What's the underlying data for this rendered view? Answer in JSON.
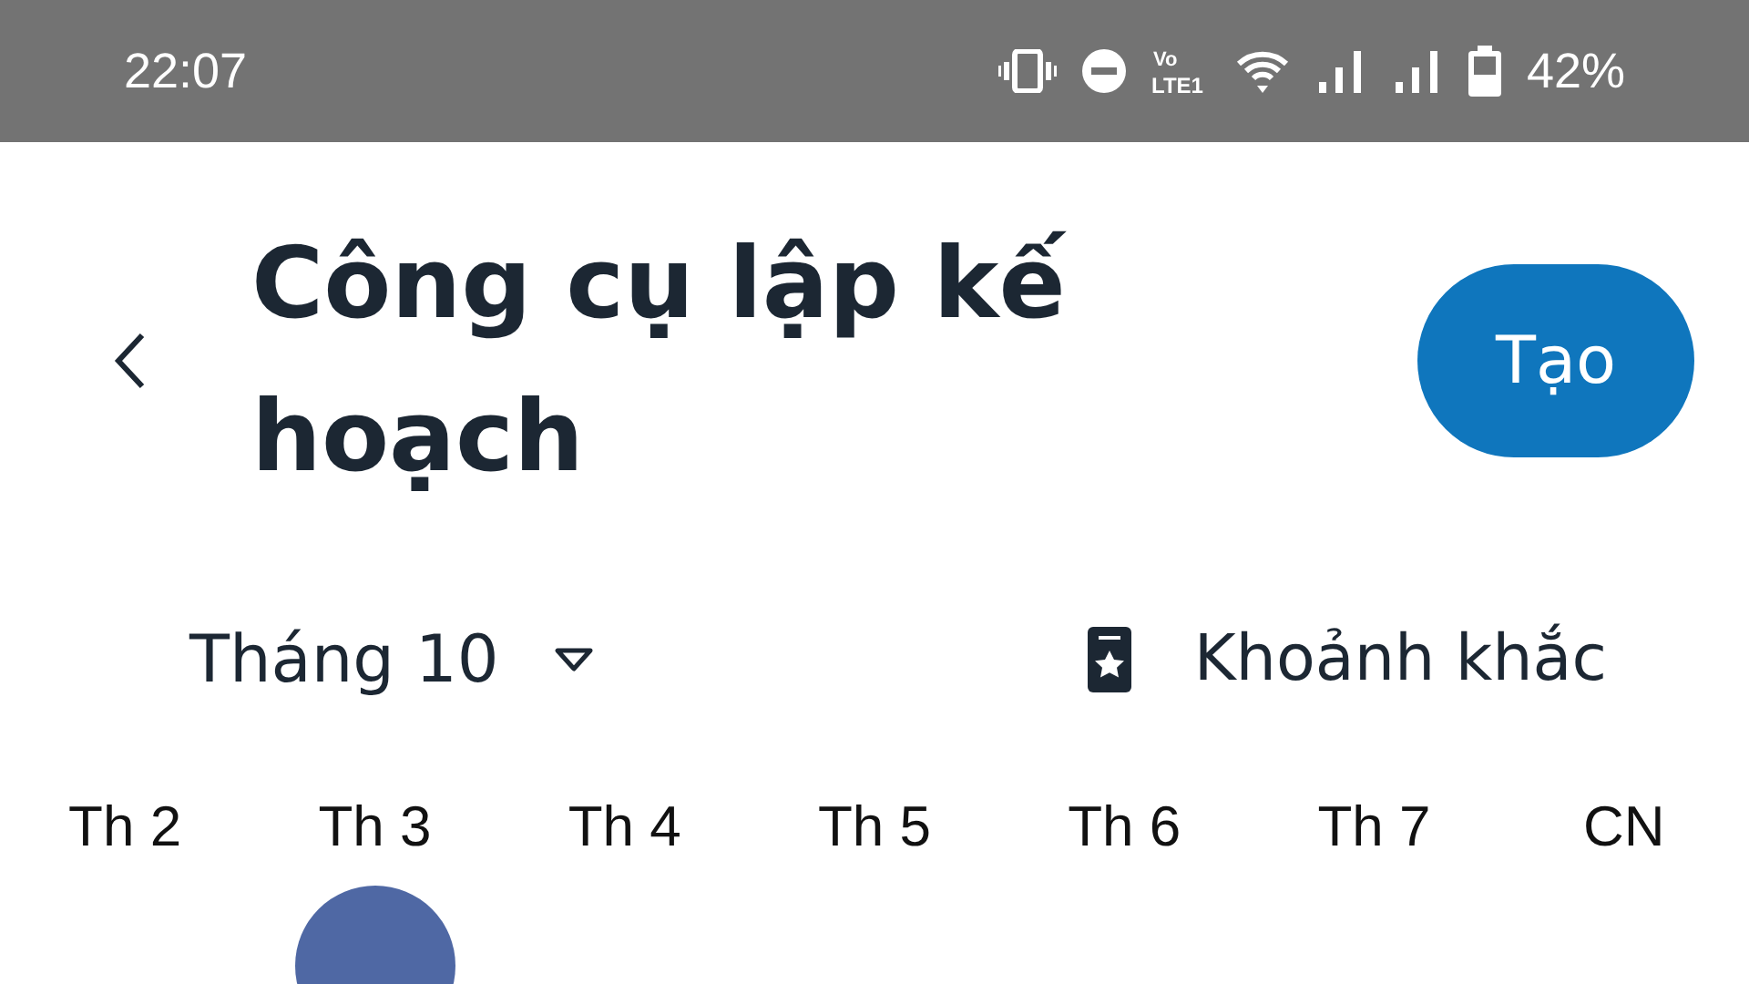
{
  "status_bar": {
    "time": "22:07",
    "volte": "Vo",
    "network": "LTE1",
    "battery": "42%"
  },
  "header": {
    "title": "Công cụ lập kế hoạch",
    "create_button": "Tạo"
  },
  "toolbar": {
    "month": "Tháng 10",
    "moments": "Khoảnh khắc"
  },
  "weekdays": [
    {
      "label": "Th 2",
      "selected": false
    },
    {
      "label": "Th 3",
      "selected": true
    },
    {
      "label": "Th 4",
      "selected": false
    },
    {
      "label": "Th 5",
      "selected": false
    },
    {
      "label": "Th 6",
      "selected": false
    },
    {
      "label": "Th 7",
      "selected": false
    },
    {
      "label": "CN",
      "selected": false
    }
  ]
}
